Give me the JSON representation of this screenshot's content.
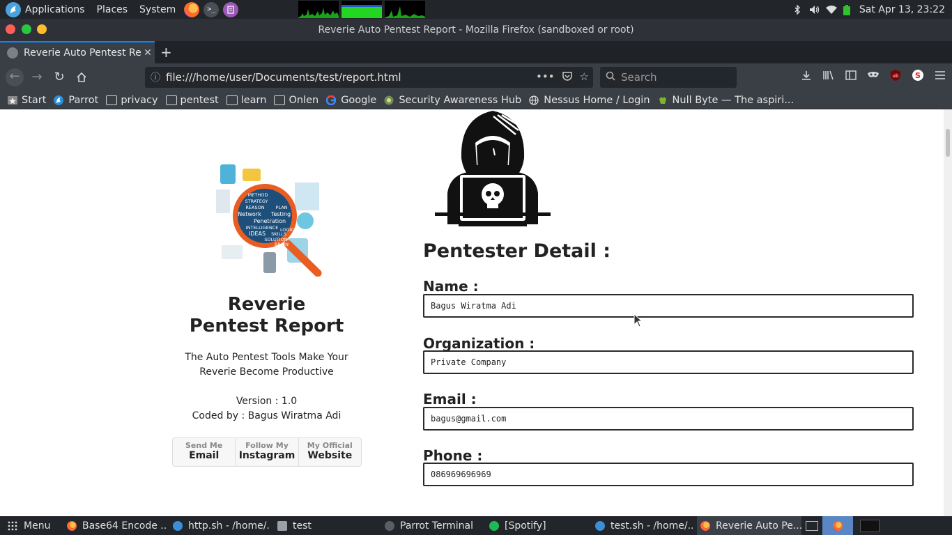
{
  "system_panel": {
    "menus": [
      "Applications",
      "Places",
      "System"
    ],
    "clock": "Sat Apr 13, 23:22"
  },
  "window": {
    "title": "Reverie Auto Pentest Report - Mozilla Firefox (sandboxed or root)"
  },
  "tabs": [
    {
      "label": "Reverie Auto Pentest Report"
    }
  ],
  "navbar": {
    "url": "file:///home/user/Documents/test/report.html",
    "search_placeholder": "Search"
  },
  "bookmarks": [
    {
      "label": "Start",
      "icon": "start-icon"
    },
    {
      "label": "Parrot",
      "icon": "parrot-icon"
    },
    {
      "label": "privacy",
      "icon": "folder-icon"
    },
    {
      "label": "pentest",
      "icon": "folder-icon"
    },
    {
      "label": "learn",
      "icon": "folder-icon"
    },
    {
      "label": "Onlen",
      "icon": "folder-icon"
    },
    {
      "label": "Google",
      "icon": "google-icon"
    },
    {
      "label": "Security Awareness Hub",
      "icon": "shield-icon"
    },
    {
      "label": "Nessus Home / Login",
      "icon": "globe-icon"
    },
    {
      "label": "Null Byte — The aspiri...",
      "icon": "nullbyte-icon"
    }
  ],
  "page": {
    "brand_line1": "Reverie",
    "brand_line2": "Pentest Report",
    "tagline_line1": "The Auto Pentest Tools Make Your",
    "tagline_line2": "Reverie Become Productive",
    "version": "Version : 1.0",
    "coded_by": "Coded by : Bagus Wiratma Adi",
    "buttons": [
      {
        "small": "Send Me",
        "big": "Email"
      },
      {
        "small": "Follow My",
        "big": "Instagram"
      },
      {
        "small": "My Official",
        "big": "Website"
      }
    ],
    "section_title": "Pentester Detail :",
    "fields": [
      {
        "label": "Name :",
        "value": "Bagus Wiratma Adi"
      },
      {
        "label": "Organization :",
        "value": "Private Company"
      },
      {
        "label": "Email :",
        "value": "bagus@gmail.com"
      },
      {
        "label": "Phone :",
        "value": "086969696969"
      }
    ],
    "magnifier_words": [
      "METHOD",
      "STRATEGY",
      "REASON",
      "PLAN",
      "Network",
      "Testing",
      "Penetration",
      "INTELLIGENCE",
      "IDEAS",
      "SKILLS",
      "LOGIC",
      "SOLUTION",
      "BRAIN"
    ]
  },
  "taskbar": {
    "menu_label": "Menu",
    "tasks": [
      {
        "label": "Base64 Encode ...",
        "icon": "firefox-icon"
      },
      {
        "label": "http.sh - /home/...",
        "icon": "editor-icon"
      },
      {
        "label": "test",
        "icon": "folder-icon"
      },
      {
        "label": "Parrot Terminal",
        "icon": "terminal-icon"
      },
      {
        "label": "[Spotify]",
        "icon": "spotify-icon"
      },
      {
        "label": "test.sh - /home/...",
        "icon": "editor-icon"
      },
      {
        "label": "Reverie Auto Pe...",
        "icon": "firefox-icon"
      }
    ]
  }
}
